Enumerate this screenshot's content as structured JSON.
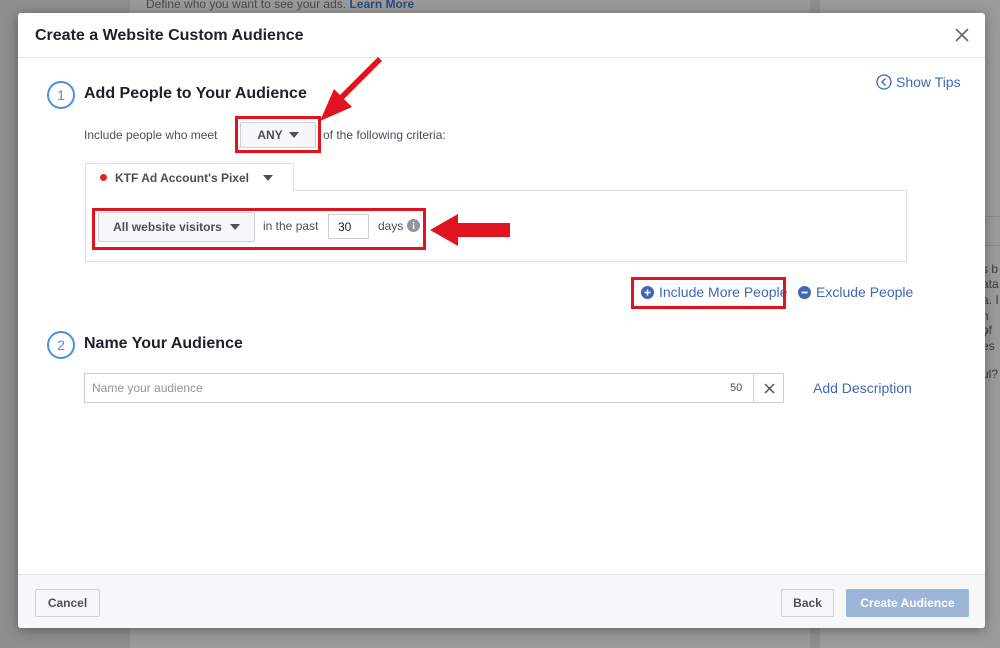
{
  "background": {
    "top_text": "Define who you want to see your ads.",
    "top_link": "Learn More",
    "right_fragments": [
      "s b",
      "ata",
      "a. I",
      "n of",
      "y es",
      "ul?"
    ]
  },
  "modal": {
    "title": "Create a Website Custom Audience",
    "show_tips": "Show Tips",
    "step1": {
      "number": "1",
      "title": "Add People to Your Audience",
      "criteria_prefix": "Include people who meet",
      "match_value": "ANY",
      "criteria_suffix": "of the following criteria:",
      "pixel_label": "KTF Ad Account's Pixel",
      "visitors_value": "All website visitors",
      "in_the_past": "in the past",
      "days_value": "30",
      "days_label": "days",
      "include_more": "Include More People",
      "exclude": "Exclude People"
    },
    "step2": {
      "number": "2",
      "title": "Name Your Audience",
      "name_placeholder": "Name your audience",
      "char_count": "50",
      "add_description": "Add Description"
    },
    "footer": {
      "cancel": "Cancel",
      "back": "Back",
      "create": "Create Audience"
    }
  },
  "colors": {
    "accent": "#4267b2",
    "step_circle": "#4a90e2",
    "annotation_red": "#e0141e",
    "pixel_dot": "#e02424"
  }
}
